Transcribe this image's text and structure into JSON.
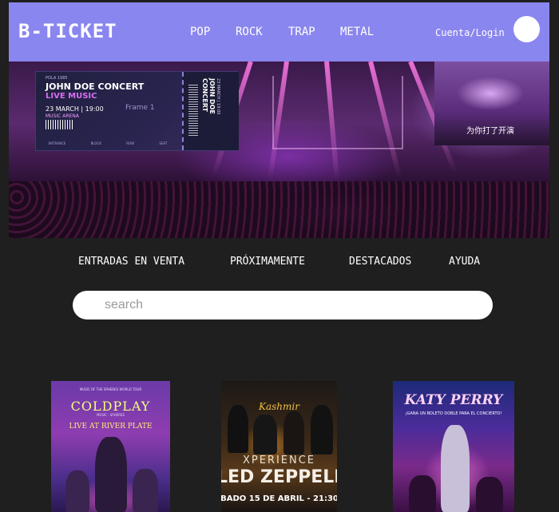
{
  "header": {
    "logo": "B-TICKET",
    "genres": [
      "POP",
      "ROCK",
      "TRAP",
      "METAL"
    ],
    "account_label": "Cuenta/Login"
  },
  "hero": {
    "ticket": {
      "top_small": "POLA 1985",
      "title": "JOHN DOE CONCERT",
      "subtitle": "LIVE MUSIC",
      "date": "23 MARCH | 19:00",
      "venue": "MUSIC ARENA",
      "frame_label": "Frame 1",
      "footer": [
        "ENTRANCE",
        "BLOCK",
        "ROW",
        "SEAT"
      ],
      "stub_title": "JOHN DOE CONCERT",
      "stub_date": "23 MARCH | 19:00"
    },
    "inset_caption": "为你打了开演"
  },
  "nav": {
    "items": [
      "ENTRADAS EN VENTA",
      "PRÓXIMAMENTE",
      "DESTACADOS",
      "AYUDA"
    ]
  },
  "search": {
    "placeholder": "search"
  },
  "posters": [
    {
      "title": "COLDPLAY",
      "top_text": "MUSIC OF THE SPHERES WORLD TOUR",
      "small_text": "MUSIC · SPHERES",
      "subtitle": "LIVE AT RIVER PLATE"
    },
    {
      "title": "Kashmir",
      "subtitle": "XPERIENCE",
      "big": "LED ZEPPELIN",
      "date": "BADO 15 DE ABRIL - 21:30"
    },
    {
      "title": "KATY PERRY",
      "subtitle": "¡GANA UN BOLETO DOBLE PARA EL CONCIERTO!"
    }
  ],
  "colors": {
    "background": "#1f1f1f",
    "header": "#8a86ef",
    "text": "#ffffff"
  }
}
